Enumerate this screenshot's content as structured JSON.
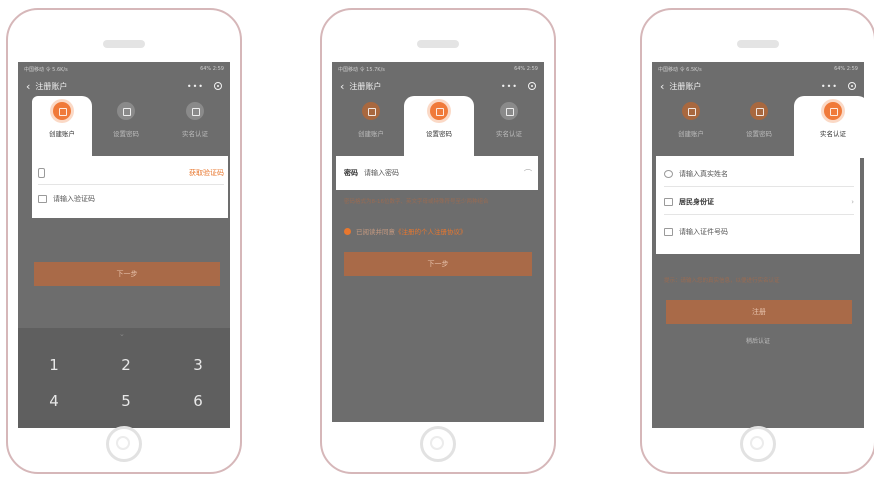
{
  "phones": [
    {
      "status_left": "中国移动 令 5.6K/s",
      "status_right": "64% 2:59",
      "title": "注册账户",
      "steps": [
        "创建账户",
        "设置密码",
        "实名认证"
      ],
      "phone_placeholder": "",
      "get_code": "获取验证码",
      "code_placeholder": "请输入验证码",
      "next": "下一步",
      "keys": [
        "1",
        "2",
        "3",
        "4",
        "5",
        "6"
      ]
    },
    {
      "status_left": "中国移动 令 15.7K/s",
      "status_right": "64% 2:59",
      "title": "注册账户",
      "steps": [
        "创建账户",
        "设置密码",
        "实名认证"
      ],
      "password_label": "密码",
      "password_placeholder": "请输入密码",
      "hint": "密码格式为8-16位数字、英文字母或特殊符号至少两种组合",
      "agree_prefix": "已阅读并同意",
      "agree_link": "《注册的个人注册协议》",
      "next": "下一步"
    },
    {
      "status_left": "中国移动 令 6.5K/s",
      "status_right": "64% 2:59",
      "title": "注册账户",
      "steps": [
        "创建账户",
        "设置密码",
        "实名认证"
      ],
      "name_placeholder": "请输入真实姓名",
      "id_type": "居民身份证",
      "id_placeholder": "请输入证件号码",
      "hint": "提示：请输入您的真实信息，以便进行实名认证",
      "register": "注册",
      "skip": "稍后认证"
    }
  ],
  "icons": [
    "back-icon",
    "more-icon",
    "record-icon",
    "home-button-icon"
  ],
  "colors": {
    "accent": "#f07a3a",
    "overlay": "#6d6d6d",
    "button": "#a96a48"
  }
}
